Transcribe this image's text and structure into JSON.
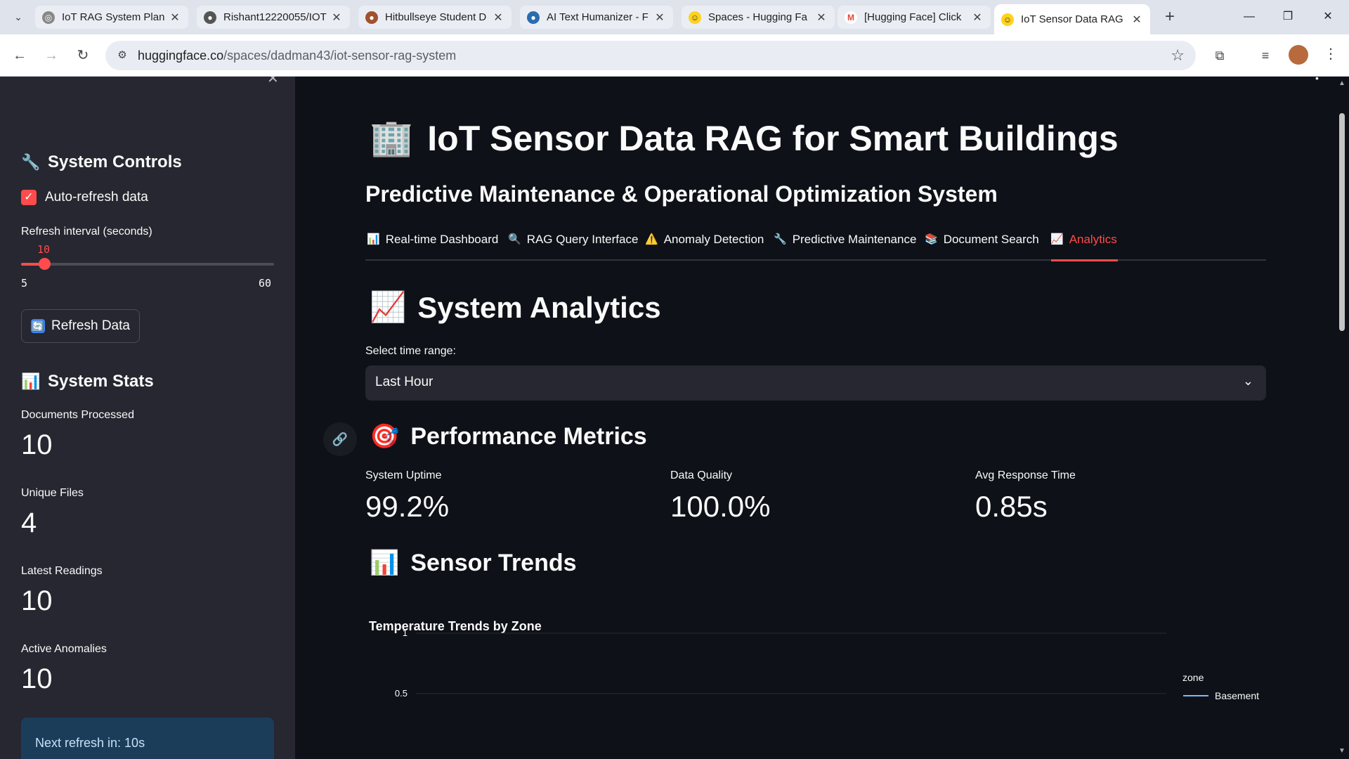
{
  "browser": {
    "tabs": [
      {
        "title": "IoT RAG System Plan",
        "favicon": "openai-icon"
      },
      {
        "title": "Rishant12220055/IOT",
        "favicon": "github-icon"
      },
      {
        "title": "Hitbullseye Student D",
        "favicon": "hitbullseye-icon"
      },
      {
        "title": "AI Text Humanizer - F",
        "favicon": "humanizer-icon"
      },
      {
        "title": "Spaces - Hugging Fa",
        "favicon": "huggingface-icon"
      },
      {
        "title": "[Hugging Face] Click",
        "favicon": "gmail-icon"
      },
      {
        "title": "IoT Sensor Data RAG",
        "favicon": "huggingface-icon"
      }
    ],
    "url_host": "huggingface.co",
    "url_path": "/spaces/dadman43/iot-sensor-rag-system"
  },
  "sidebar": {
    "controls_heading": "System Controls",
    "controls_emoji": "🔧",
    "auto_refresh_label": "Auto-refresh data",
    "auto_refresh_checked": true,
    "slider_label": "Refresh interval (seconds)",
    "slider_value": "10",
    "slider_min": "5",
    "slider_max": "60",
    "refresh_button": "Refresh Data",
    "refresh_emoji": "🔄",
    "stats_heading": "System Stats",
    "stats_emoji": "📊",
    "stats": [
      {
        "label": "Documents Processed",
        "value": "10"
      },
      {
        "label": "Unique Files",
        "value": "4"
      },
      {
        "label": "Latest Readings",
        "value": "10"
      },
      {
        "label": "Active Anomalies",
        "value": "10"
      }
    ],
    "next_refresh": "Next refresh in: 10s"
  },
  "main": {
    "title": "IoT Sensor Data RAG for Smart Buildings",
    "title_emoji": "🏢",
    "subtitle": "Predictive Maintenance & Operational Optimization System",
    "tabs": [
      {
        "emoji": "📊",
        "label": "Real-time Dashboard"
      },
      {
        "emoji": "🔍",
        "label": "RAG Query Interface"
      },
      {
        "emoji": "⚠️",
        "label": "Anomaly Detection"
      },
      {
        "emoji": "🔧",
        "label": "Predictive Maintenance"
      },
      {
        "emoji": "📚",
        "label": "Document Search"
      },
      {
        "emoji": "📈",
        "label": "Analytics"
      }
    ],
    "active_tab": "Analytics",
    "section_heading": "System Analytics",
    "section_emoji": "📈",
    "select_label": "Select time range:",
    "select_value": "Last Hour",
    "performance_heading": "Performance Metrics",
    "performance_emoji": "🎯",
    "metrics": [
      {
        "label": "System Uptime",
        "value": "99.2%"
      },
      {
        "label": "Data Quality",
        "value": "100.0%"
      },
      {
        "label": "Avg Response Time",
        "value": "0.85s"
      }
    ],
    "trends_heading": "Sensor Trends",
    "trends_emoji": "📊"
  },
  "colors": {
    "accent": "#ff4b4b",
    "background": "#0e1117",
    "sidebar": "#262730",
    "info_box": "#1c3d5a",
    "series_basemant": "#7db7ff"
  },
  "chart_data": {
    "type": "line",
    "title": "Temperature Trends by Zone",
    "legend_title": "zone",
    "legend_position": "top-right",
    "series": [
      {
        "name": "Basement",
        "color": "#7db7ff",
        "values": []
      }
    ],
    "y_ticks": [
      "1",
      "0.5"
    ],
    "grid": true
  }
}
